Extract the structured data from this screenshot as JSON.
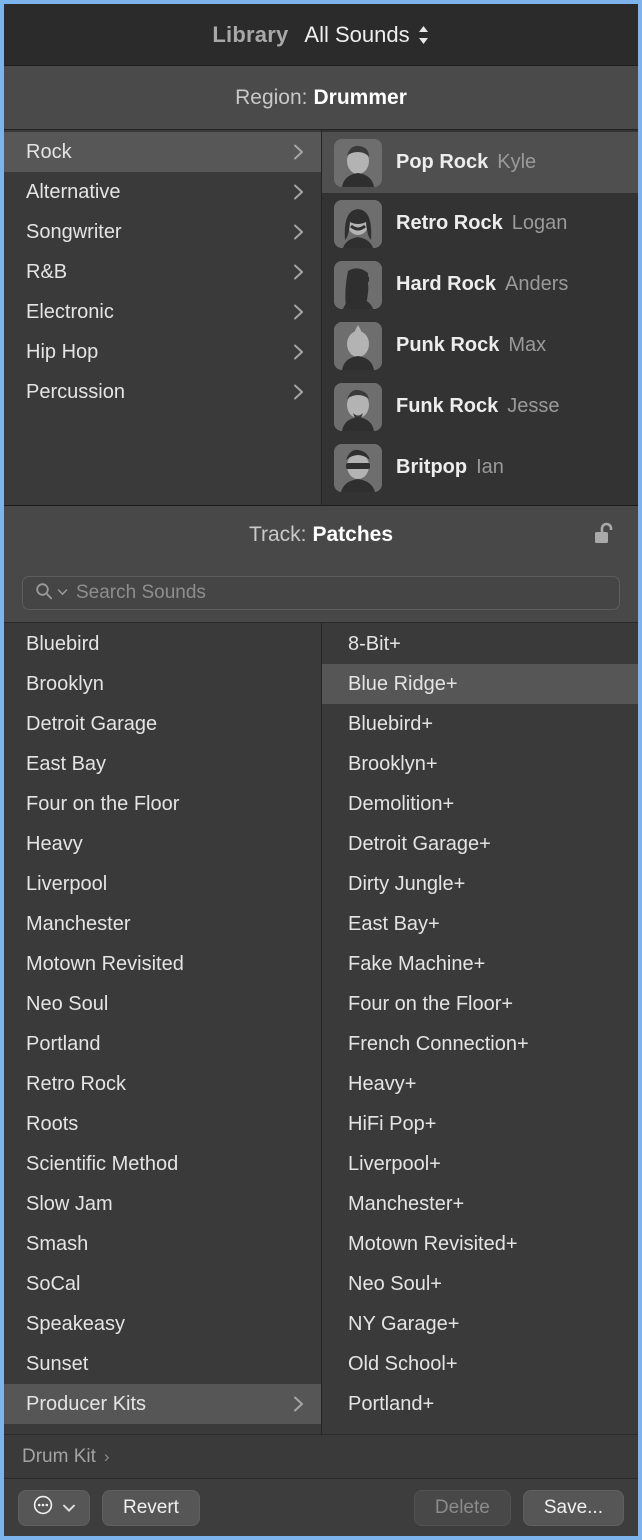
{
  "header": {
    "library_label": "Library",
    "sound_set": "All Sounds",
    "popup_icon": "updown-chevrons-icon"
  },
  "region_bar": {
    "prefix": "Region:",
    "value": "Drummer"
  },
  "genres": {
    "items": [
      {
        "label": "Rock",
        "selected": true,
        "disclosure": "chevron-right-icon"
      },
      {
        "label": "Alternative",
        "selected": false,
        "disclosure": "chevron-right-icon"
      },
      {
        "label": "Songwriter",
        "selected": false,
        "disclosure": "chevron-right-icon"
      },
      {
        "label": "R&B",
        "selected": false,
        "disclosure": "chevron-right-icon"
      },
      {
        "label": "Electronic",
        "selected": false,
        "disclosure": "chevron-right-icon"
      },
      {
        "label": "Hip Hop",
        "selected": false,
        "disclosure": "chevron-right-icon"
      },
      {
        "label": "Percussion",
        "selected": false,
        "disclosure": "chevron-right-icon"
      }
    ]
  },
  "drummers": {
    "items": [
      {
        "style": "Pop Rock",
        "name": "Kyle",
        "selected": true,
        "avatar": "avatar-kyle"
      },
      {
        "style": "Retro Rock",
        "name": "Logan",
        "selected": false,
        "avatar": "avatar-logan"
      },
      {
        "style": "Hard Rock",
        "name": "Anders",
        "selected": false,
        "avatar": "avatar-anders"
      },
      {
        "style": "Punk Rock",
        "name": "Max",
        "selected": false,
        "avatar": "avatar-max"
      },
      {
        "style": "Funk Rock",
        "name": "Jesse",
        "selected": false,
        "avatar": "avatar-jesse"
      },
      {
        "style": "Britpop",
        "name": "Ian",
        "selected": false,
        "avatar": "avatar-ian"
      }
    ]
  },
  "track_bar": {
    "prefix": "Track:",
    "value": "Patches",
    "lock_icon": "unlocked-padlock-icon"
  },
  "search": {
    "placeholder": "Search Sounds",
    "value": "",
    "icon": "search-icon",
    "menu_icon": "chevron-down-icon"
  },
  "patches_left": {
    "items": [
      {
        "label": "Bluebird",
        "selected": false,
        "disclosure": false
      },
      {
        "label": "Brooklyn",
        "selected": false,
        "disclosure": false
      },
      {
        "label": "Detroit Garage",
        "selected": false,
        "disclosure": false
      },
      {
        "label": "East Bay",
        "selected": false,
        "disclosure": false
      },
      {
        "label": "Four on the Floor",
        "selected": false,
        "disclosure": false
      },
      {
        "label": "Heavy",
        "selected": false,
        "disclosure": false
      },
      {
        "label": "Liverpool",
        "selected": false,
        "disclosure": false
      },
      {
        "label": "Manchester",
        "selected": false,
        "disclosure": false
      },
      {
        "label": "Motown Revisited",
        "selected": false,
        "disclosure": false
      },
      {
        "label": "Neo Soul",
        "selected": false,
        "disclosure": false
      },
      {
        "label": "Portland",
        "selected": false,
        "disclosure": false
      },
      {
        "label": "Retro Rock",
        "selected": false,
        "disclosure": false
      },
      {
        "label": "Roots",
        "selected": false,
        "disclosure": false
      },
      {
        "label": "Scientific Method",
        "selected": false,
        "disclosure": false
      },
      {
        "label": "Slow Jam",
        "selected": false,
        "disclosure": false
      },
      {
        "label": "Smash",
        "selected": false,
        "disclosure": false
      },
      {
        "label": "SoCal",
        "selected": false,
        "disclosure": false
      },
      {
        "label": "Speakeasy",
        "selected": false,
        "disclosure": false
      },
      {
        "label": "Sunset",
        "selected": false,
        "disclosure": false
      },
      {
        "label": "Producer Kits",
        "selected": true,
        "disclosure": true
      }
    ]
  },
  "patches_right": {
    "items": [
      {
        "label": "8-Bit+",
        "selected": false
      },
      {
        "label": "Blue Ridge+",
        "selected": true
      },
      {
        "label": "Bluebird+",
        "selected": false
      },
      {
        "label": "Brooklyn+",
        "selected": false
      },
      {
        "label": "Demolition+",
        "selected": false
      },
      {
        "label": "Detroit Garage+",
        "selected": false
      },
      {
        "label": "Dirty Jungle+",
        "selected": false
      },
      {
        "label": "East Bay+",
        "selected": false
      },
      {
        "label": "Fake Machine+",
        "selected": false
      },
      {
        "label": "Four on the Floor+",
        "selected": false
      },
      {
        "label": "French Connection+",
        "selected": false
      },
      {
        "label": "Heavy+",
        "selected": false
      },
      {
        "label": "HiFi Pop+",
        "selected": false
      },
      {
        "label": "Liverpool+",
        "selected": false
      },
      {
        "label": "Manchester+",
        "selected": false
      },
      {
        "label": "Motown Revisited+",
        "selected": false
      },
      {
        "label": "Neo Soul+",
        "selected": false
      },
      {
        "label": "NY Garage+",
        "selected": false
      },
      {
        "label": "Old School+",
        "selected": false
      },
      {
        "label": "Portland+",
        "selected": false
      }
    ]
  },
  "breadcrumb": {
    "label": "Drum Kit",
    "chevron": "›"
  },
  "footer": {
    "action_menu_icon": "ellipsis-circle-icon",
    "action_menu_chevron": "chevron-down-icon",
    "revert_label": "Revert",
    "delete_label": "Delete",
    "delete_enabled": false,
    "save_label": "Save..."
  },
  "colors": {
    "window_border": "#7db4ee",
    "panel_bg": "#3a3a3a",
    "header_bg": "#2b2b2b",
    "region_bg": "#4a4a4a",
    "selection": "#565656",
    "text": "#e4e4e4",
    "text_dim": "#9a9a9a"
  }
}
